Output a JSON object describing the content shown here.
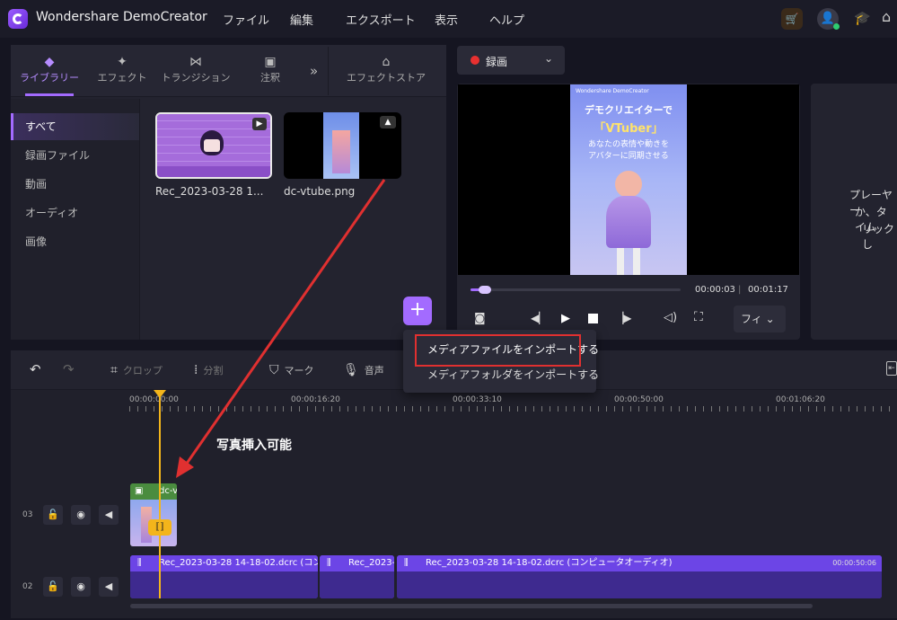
{
  "app": {
    "title": "Wondershare DemoCreator"
  },
  "menu": [
    "ファイル",
    "編集",
    "エクスポート",
    "表示",
    "ヘルプ"
  ],
  "colors": {
    "accent": "#a36bff",
    "arrow": "#e03030",
    "playhead": "#f3b51b"
  },
  "tabs": [
    {
      "label": "ライブラリー",
      "icon": "layers-icon"
    },
    {
      "label": "エフェクト",
      "icon": "sparkle-icon"
    },
    {
      "label": "トランジション",
      "icon": "transition-icon"
    },
    {
      "label": "注釈",
      "icon": "annotation-icon"
    },
    {
      "label": "エフェクトストア",
      "icon": "store-icon"
    }
  ],
  "sidebar": [
    "すべて",
    "録画ファイル",
    "動画",
    "オーディオ",
    "画像"
  ],
  "media": [
    {
      "name": "Rec_2023-03-28 1...",
      "type": "video-icon"
    },
    {
      "name": "dc-vtube.png",
      "type": "image-icon"
    }
  ],
  "record": {
    "label": "録画"
  },
  "preview": {
    "brand": "Wondershare DemoCreator",
    "line1": "デモクリエイターで",
    "line2": "「VTuber」",
    "line3": "あなたの表情や動きを",
    "line4": "アバターに同期させる",
    "time_current": "00:00:03",
    "time_total": "00:01:17",
    "progress": 0.07,
    "fit": "フィ"
  },
  "side_panel": {
    "line1": "プレーヤー",
    "line2": "か、タイム",
    "line3": "リックし"
  },
  "import_menu": [
    "メディアファイルをインポートする",
    "メディアフォルダをインポートする"
  ],
  "toolbar": {
    "crop": "クロップ",
    "split": "分割",
    "mark": "マーク",
    "audio": "音声"
  },
  "ruler": [
    "00:00:00:00",
    "00:00:16:20",
    "00:00:33:10",
    "00:00:50:00",
    "00:01:06:20"
  ],
  "annotation": "写真挿入可能",
  "tracks": [
    {
      "num": "03",
      "clips": [
        {
          "name": "dc-v"
        }
      ]
    },
    {
      "num": "02",
      "clips": [
        {
          "name": "Rec_2023-03-28 14-18-02.dcrc (コン"
        },
        {
          "name": "Rec_2023-"
        },
        {
          "name": "Rec_2023-03-28 14-18-02.dcrc (コンピュータオーディオ)",
          "time": "00:00:50:06"
        }
      ]
    }
  ]
}
